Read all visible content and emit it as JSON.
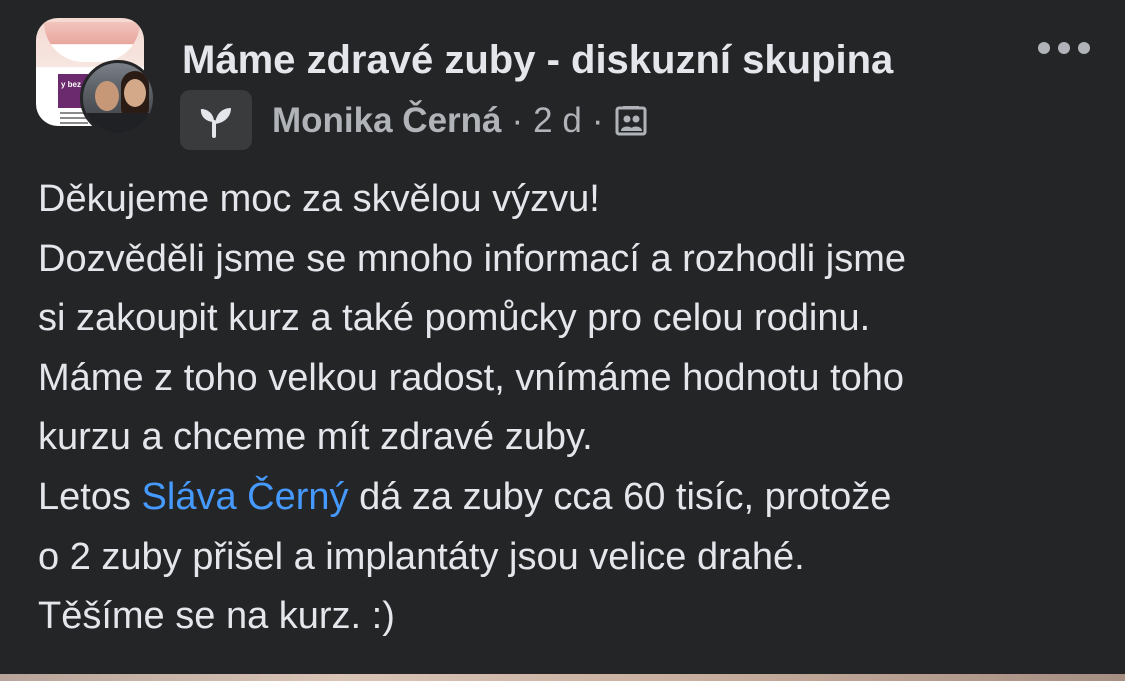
{
  "header": {
    "group_name": "Máme zdravé zuby - diskuzní skupina",
    "author": "Monika Černá",
    "separator": "·",
    "time": "2 d",
    "audience_icon": "members-icon",
    "badge_icon": "sprout-icon",
    "more_icon": "more-options-icon",
    "group_avatar_text": "y bez"
  },
  "post": {
    "line1": "Děkujeme moc za skvělou výzvu!",
    "line2": "Dozvěděli jsme se mnoho informací a rozhodli jsme",
    "line3": "si zakoupit kurz a také pomůcky pro celou rodinu.",
    "line4": "Máme z toho velkou radost, vnímáme hodnotu toho",
    "line5": "kurzu a chceme mít zdravé zuby.",
    "line6_before": "Letos ",
    "mention": "Sláva Černý",
    "line6_after": " dá za zuby cca 60 tisíc, protože",
    "line7": "o 2 zuby přišel a implantáty jsou velice drahé.",
    "line8": "Těšíme se na kurz. :)"
  },
  "colors": {
    "background": "#242526",
    "text": "#e4e6eb",
    "secondary_text": "#b0b3b8",
    "mention": "#4599ff",
    "badge_bg": "#3a3b3c"
  }
}
